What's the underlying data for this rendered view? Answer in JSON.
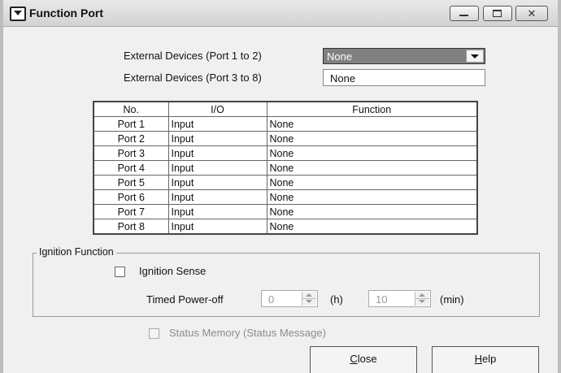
{
  "window": {
    "title": "Function Port",
    "close_glyph": "✕"
  },
  "external": {
    "label_1_2": "External Devices (Port 1 to 2)",
    "value_1_2": "None",
    "label_3_8": "External Devices (Port 3 to 8)",
    "value_3_8": "None"
  },
  "table": {
    "headers": [
      "No.",
      "I/O",
      "Function"
    ],
    "rows": [
      [
        "Port 1",
        "Input",
        "None"
      ],
      [
        "Port 2",
        "Input",
        "None"
      ],
      [
        "Port 3",
        "Input",
        "None"
      ],
      [
        "Port 4",
        "Input",
        "None"
      ],
      [
        "Port 5",
        "Input",
        "None"
      ],
      [
        "Port 6",
        "Input",
        "None"
      ],
      [
        "Port 7",
        "Input",
        "None"
      ],
      [
        "Port 8",
        "Input",
        "None"
      ]
    ]
  },
  "ignition": {
    "group_title": "Ignition Function",
    "sense_label": "Ignition Sense",
    "timed_label": "Timed Power-off",
    "hours_value": "0",
    "hours_unit": "(h)",
    "minutes_value": "10",
    "minutes_unit": "(min)"
  },
  "status_memory": {
    "label": "Status Memory (Status Message)"
  },
  "buttons": {
    "close_first": "C",
    "close_rest": "lose",
    "help_first": "H",
    "help_rest": "elp"
  },
  "icons": {
    "app": "window-app-icon",
    "minimize": "minimize-icon",
    "maximize": "maximize-icon",
    "close": "close-icon",
    "dropdown": "chevron-down-icon",
    "spin": "spinner-arrows-icon"
  }
}
